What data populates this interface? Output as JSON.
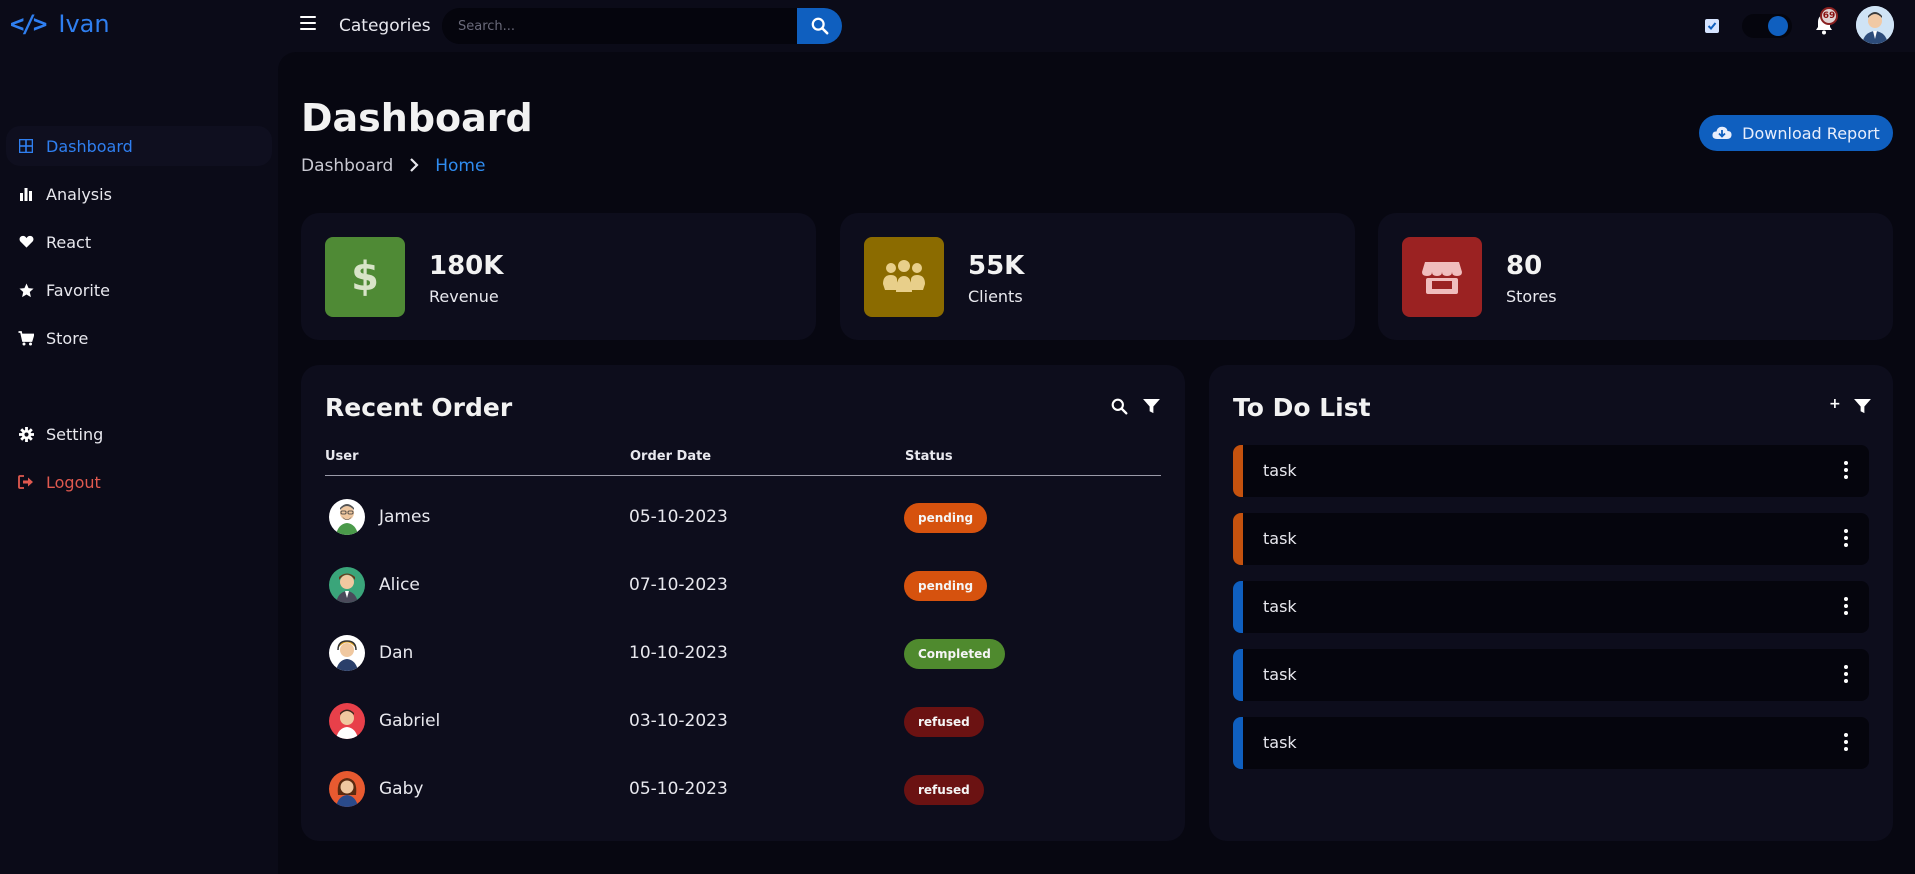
{
  "brand": {
    "name": "Ivan",
    "icon": "code-icon"
  },
  "topbar": {
    "categories_label": "Categories",
    "search_placeholder": "Search...",
    "notification_count": "69",
    "accent": "#0f5fbf"
  },
  "sidebar": {
    "items": [
      {
        "label": "Dashboard",
        "icon": "grid-icon",
        "active": true
      },
      {
        "label": "Analysis",
        "icon": "bar-chart-icon"
      },
      {
        "label": "React",
        "icon": "heart-icon"
      },
      {
        "label": "Favorite",
        "icon": "star-icon"
      },
      {
        "label": "Store",
        "icon": "cart-icon"
      },
      {
        "label": "Setting",
        "icon": "gear-icon"
      },
      {
        "label": "Logout",
        "icon": "logout-icon"
      }
    ]
  },
  "header": {
    "title": "Dashboard",
    "breadcrumb": [
      "Dashboard",
      "Home"
    ],
    "download_label": "Download Report"
  },
  "stats": [
    {
      "value": "180K",
      "label": "Revenue",
      "icon": "dollar-icon",
      "color": "#4f8a35"
    },
    {
      "value": "55K",
      "label": "Clients",
      "icon": "people-icon",
      "color": "#8b6b00"
    },
    {
      "value": "80",
      "label": "Stores",
      "icon": "store-icon",
      "color": "#9b2222"
    }
  ],
  "orders": {
    "title": "Recent Order",
    "columns": [
      "User",
      "Order Date",
      "Status"
    ],
    "rows": [
      {
        "user": "James",
        "date": "05-10-2023",
        "status": "pending"
      },
      {
        "user": "Alice",
        "date": "07-10-2023",
        "status": "pending"
      },
      {
        "user": "Dan",
        "date": "10-10-2023",
        "status": "Completed"
      },
      {
        "user": "Gabriel",
        "date": "03-10-2023",
        "status": "refused"
      },
      {
        "user": "Gaby",
        "date": "05-10-2023",
        "status": "refused"
      }
    ]
  },
  "todo": {
    "title": "To Do List",
    "add_label": "+",
    "items": [
      {
        "label": "task",
        "color": "#c5520e"
      },
      {
        "label": "task",
        "color": "#c5520e"
      },
      {
        "label": "task",
        "color": "#0f5fbf"
      },
      {
        "label": "task",
        "color": "#0f5fbf"
      },
      {
        "label": "task",
        "color": "#0f5fbf"
      }
    ]
  }
}
